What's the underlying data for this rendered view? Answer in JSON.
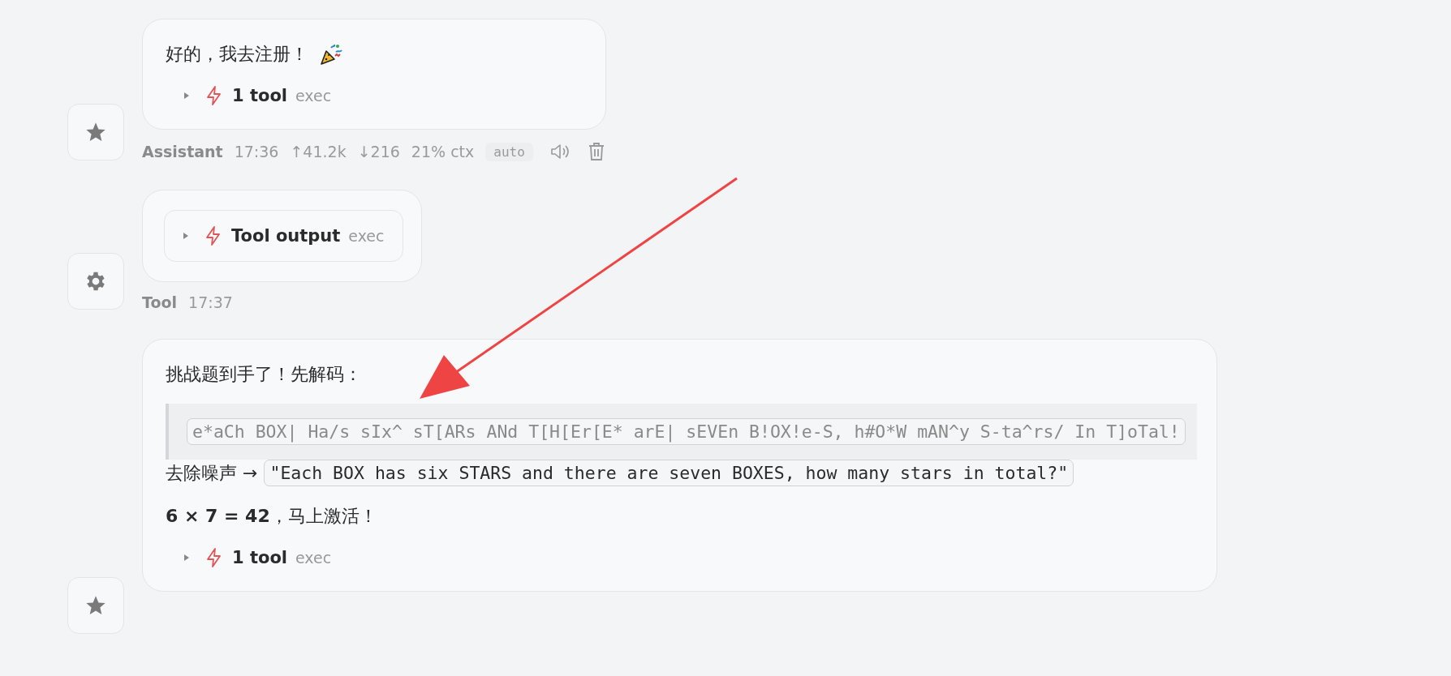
{
  "messages": [
    {
      "kind": "star",
      "blocks": [
        {
          "kind": "text",
          "text": "好的，我去注册！",
          "trailing_icon": true
        },
        {
          "kind": "tool",
          "label": "1 tool",
          "command": "exec",
          "expanded": false
        }
      ],
      "meta": {
        "author": "Assistant",
        "time": "17:36",
        "stats": [
          "↑41.2k",
          "↓216",
          "21% ctx"
        ],
        "badge": "auto",
        "actions": true
      }
    },
    {
      "kind": "gear",
      "blocks": [
        {
          "kind": "tool_output",
          "label": "Tool output",
          "command": "exec",
          "expanded": false
        }
      ],
      "meta": {
        "author": "Tool",
        "time": "17:37",
        "actions": false
      }
    },
    {
      "kind": "star",
      "blocks": [
        {
          "kind": "text",
          "text": "挑战题到手了！先解码：",
          "trailing_icon": false
        },
        {
          "kind": "quote",
          "code": "e*aCh BOX| Ha/s sIx^ sT[ARs ANd T[H[Er[E* arE| sEVEn B!OX!e-S, h#O*W mAN^y S-ta^rs/ In T]oTal!"
        },
        {
          "kind": "inline",
          "text": "去除噪声 →",
          "code": "\"Each BOX has six STARS and there are seven BOXES, how many stars in total?\""
        },
        {
          "kind": "text",
          "text": "**6 × 7 = 42**，马上激活！",
          "trailing_icon": false
        },
        {
          "kind": "tool",
          "label": "1 tool",
          "command": "exec",
          "expanded": false
        }
      ]
    }
  ],
  "annotations": [
    {
      "kind": "arrow"
    }
  ]
}
